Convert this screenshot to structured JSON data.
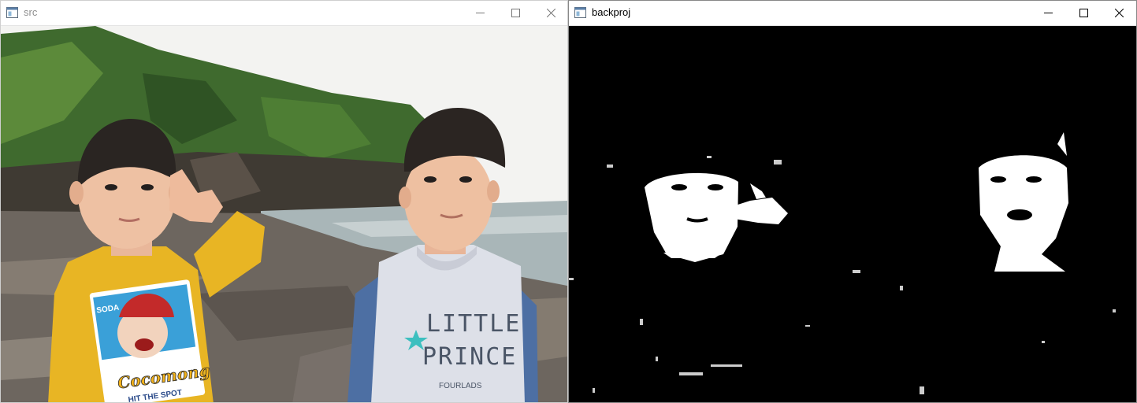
{
  "windows": {
    "src": {
      "title": "src",
      "icon": "app-window-icon"
    },
    "backproj": {
      "title": "backproj",
      "icon": "app-window-icon"
    }
  },
  "controls": {
    "minimize": "minimize-icon",
    "maximize": "maximize-icon",
    "close": "close-icon"
  },
  "shirt_left": {
    "brand_top": "SODA",
    "brand": "Cocomong",
    "tagline": "HIT THE SPOT"
  },
  "shirt_right": {
    "line1": "LITTLE",
    "line2": "PRINCE",
    "line3": "FOURLADS"
  },
  "colors": {
    "sky": "#f3f3f1",
    "forest": "#3f6a2e",
    "rock": "#6d665f",
    "sea": "#a9b6b8",
    "yellow_shirt": "#e8b524",
    "white_shirt": "#dde0e8",
    "sleeve_blue": "#4d6fa3"
  }
}
